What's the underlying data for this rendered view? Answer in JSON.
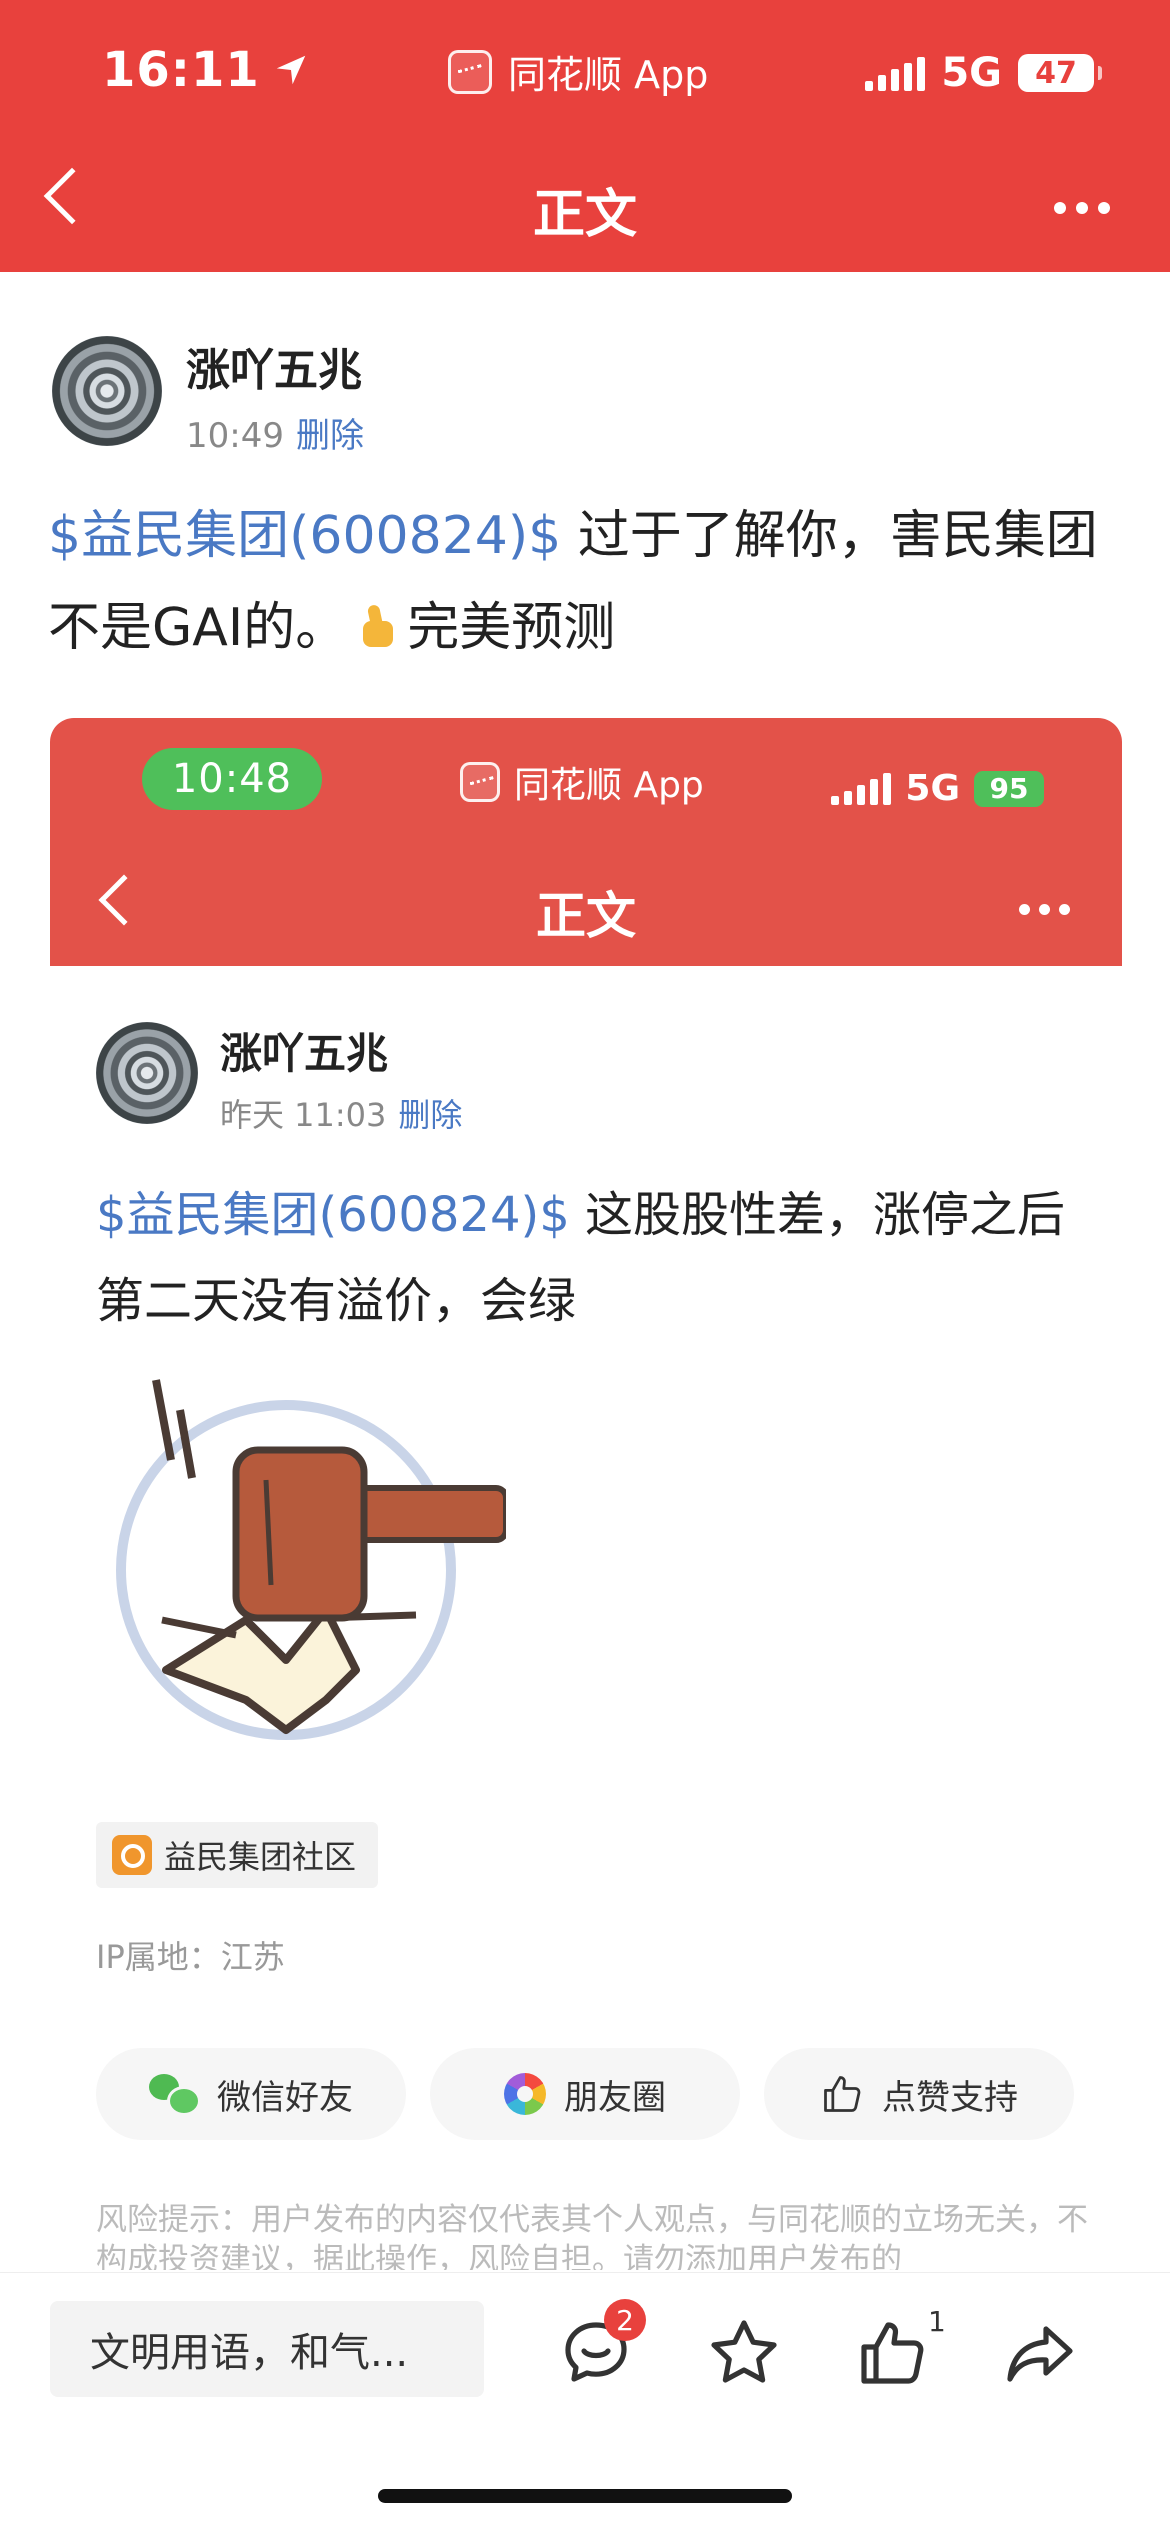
{
  "status_bar": {
    "time": "16:11",
    "app_name": "同花顺 App",
    "network": "5G",
    "battery": "47"
  },
  "nav": {
    "title": "正文"
  },
  "post": {
    "author": "涨吖五兆",
    "time": "10:49",
    "delete_label": "删除",
    "stock_tag": "$益民集团(600824)$",
    "text_part1": " 过于了解你，害民集团不是GAI的。",
    "text_part2": "完美预测"
  },
  "embedded": {
    "status_time": "10:48",
    "app_name": "同花顺 App",
    "network": "5G",
    "battery": "95",
    "nav_title": "正文",
    "author": "涨吖五兆",
    "time": "昨天 11:03",
    "delete_label": "删除",
    "stock_tag": "$益民集团(600824)$",
    "text": " 这股股性差，涨停之后第二天没有溢价，会绿",
    "community": "益民集团社区",
    "ip": "IP属地：江苏",
    "share": {
      "wechat": "微信好友",
      "moments": "朋友圈",
      "like": "点赞支持"
    },
    "risk": "风险提示：用户发布的内容仅代表其个人观点，与同花顺的立场无关，不构成投资建议，据此操作，风险自担。请勿添加用户发布的"
  },
  "bottom_bar": {
    "comment_placeholder": "文明用语，和气...",
    "comment_badge": "2",
    "like_count": "1"
  },
  "icons": [
    "location-arrow-icon",
    "app-logo-icon",
    "signal-icon",
    "battery-icon",
    "back-chevron-icon",
    "more-dots-icon",
    "thumbs-up-emoji",
    "hammer-sticker",
    "community-icon",
    "wechat-icon",
    "moments-icon",
    "like-icon",
    "comment-icon",
    "star-icon",
    "share-icon"
  ],
  "colors": {
    "header_red": "#e8413d",
    "embed_red": "#e35249",
    "link_blue": "#4a79c4",
    "status_green": "#4fbf5a",
    "badge_red": "#e8413d"
  }
}
